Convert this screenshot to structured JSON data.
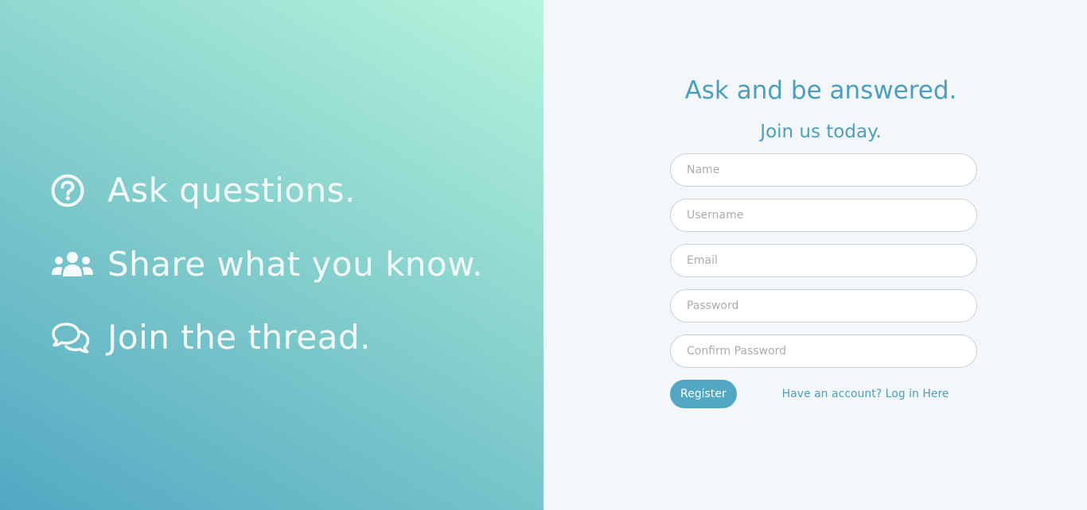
{
  "features": [
    {
      "icon": "question-circle-icon",
      "text": "Ask questions."
    },
    {
      "icon": "users-icon",
      "text": "Share what you know."
    },
    {
      "icon": "comments-icon",
      "text": "Join the thread."
    }
  ],
  "register": {
    "headline": "Ask and be answered.",
    "subheadline": "Join us today.",
    "fields": {
      "name_placeholder": "Name",
      "username_placeholder": "Username",
      "email_placeholder": "Email",
      "password_placeholder": "Password",
      "confirm_password_placeholder": "Confirm Password"
    },
    "submit_label": "Register",
    "login_link_label": "Have an account? Log in Here"
  },
  "colors": {
    "gradient_start": "#52a8c3",
    "gradient_end": "#b6f5dc",
    "accent": "#4a9fc0",
    "right_background": "#f3f7fa"
  }
}
